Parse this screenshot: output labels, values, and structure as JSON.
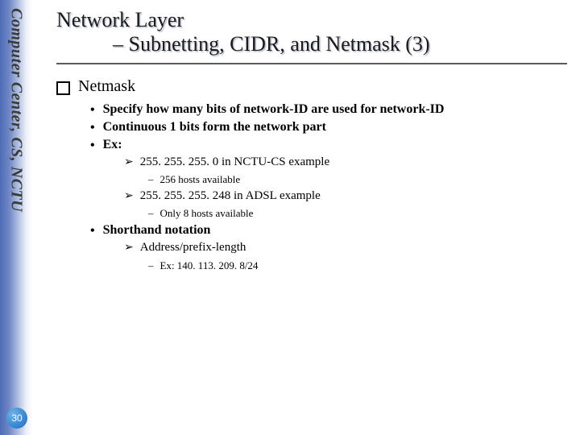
{
  "sidebar_text": "Computer Center, CS, NCTU",
  "page_number": "30",
  "title": {
    "line1": "Network Layer",
    "line2": "– Subnetting, CIDR, and Netmask (3)"
  },
  "section_heading": "Netmask",
  "bullets": [
    "Specify how many bits of network-ID are used for network-ID",
    "Continuous 1 bits form the network part",
    "Ex:"
  ],
  "examples": [
    {
      "text": "255. 255. 255. 0 in NCTU-CS example",
      "detail": "256 hosts available"
    },
    {
      "text": "255. 255. 255. 248 in ADSL example",
      "detail": "Only 8 hosts available"
    }
  ],
  "shorthand": {
    "label": "Shorthand notation",
    "sub": "Address/prefix-length",
    "example": "Ex: 140. 113. 209. 8/24"
  }
}
